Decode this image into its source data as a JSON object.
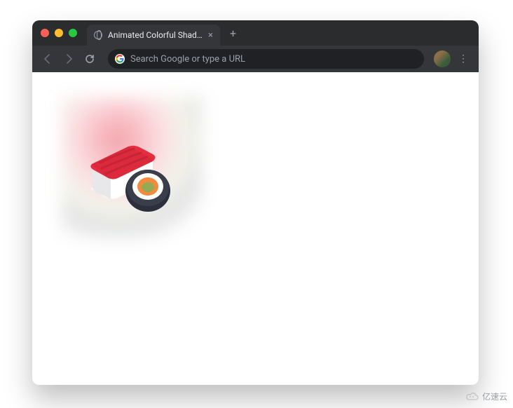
{
  "window": {
    "tab_title": "Animated Colorful Shadow",
    "new_tab_label": "+",
    "close_label": "×"
  },
  "toolbar": {
    "search_placeholder": "Search Google or type a URL",
    "google_g": "G",
    "menu_label": "⋮"
  },
  "content": {
    "illustration_name": "sushi-emoji",
    "colors": {
      "tuna": "#e72d40",
      "tuna_dark": "#c72436",
      "rice": "#ffffff",
      "rice_shade": "#e8e8ea",
      "nori": "#2d303c",
      "salmon": "#f28c3c",
      "wasabi": "#94aa54"
    }
  },
  "watermark": {
    "text": "亿速云"
  }
}
